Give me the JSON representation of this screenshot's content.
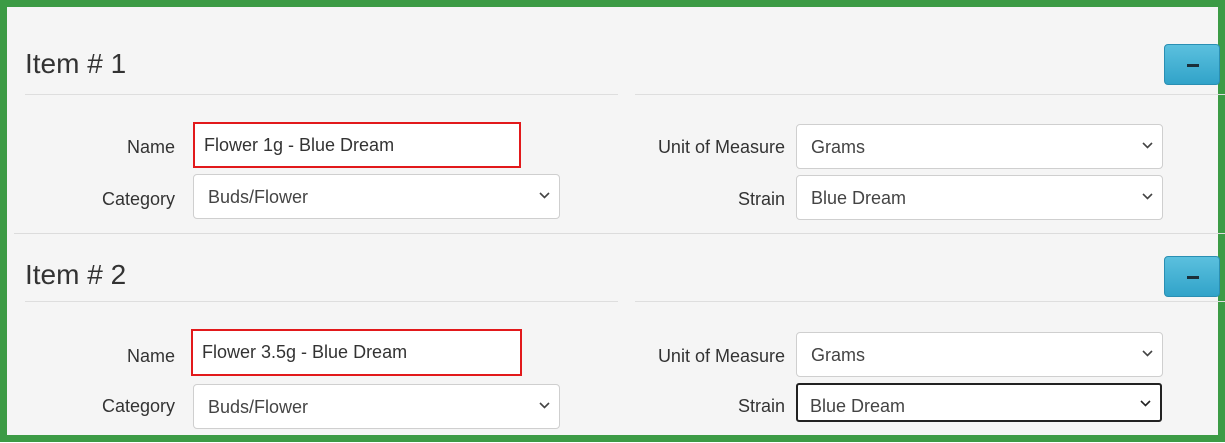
{
  "items": [
    {
      "title": "Item # 1",
      "name_label": "Name",
      "name_value": "Flower 1g - Blue Dream",
      "category_label": "Category",
      "category_value": "Buds/Flower",
      "uom_label": "Unit of Measure",
      "uom_value": "Grams",
      "strain_label": "Strain",
      "strain_value": "Blue Dream"
    },
    {
      "title": "Item # 2",
      "name_label": "Name",
      "name_value": "Flower 3.5g - Blue Dream",
      "category_label": "Category",
      "category_value": "Buds/Flower",
      "uom_label": "Unit of Measure",
      "uom_value": "Grams",
      "strain_label": "Strain",
      "strain_value": "Blue Dream"
    }
  ],
  "icons": {
    "remove": "minus-icon",
    "dropdown": "chevron-down-icon"
  },
  "colors": {
    "frame": "#3c9b45",
    "highlight": "#e2191b",
    "button": "#5bc0de"
  }
}
